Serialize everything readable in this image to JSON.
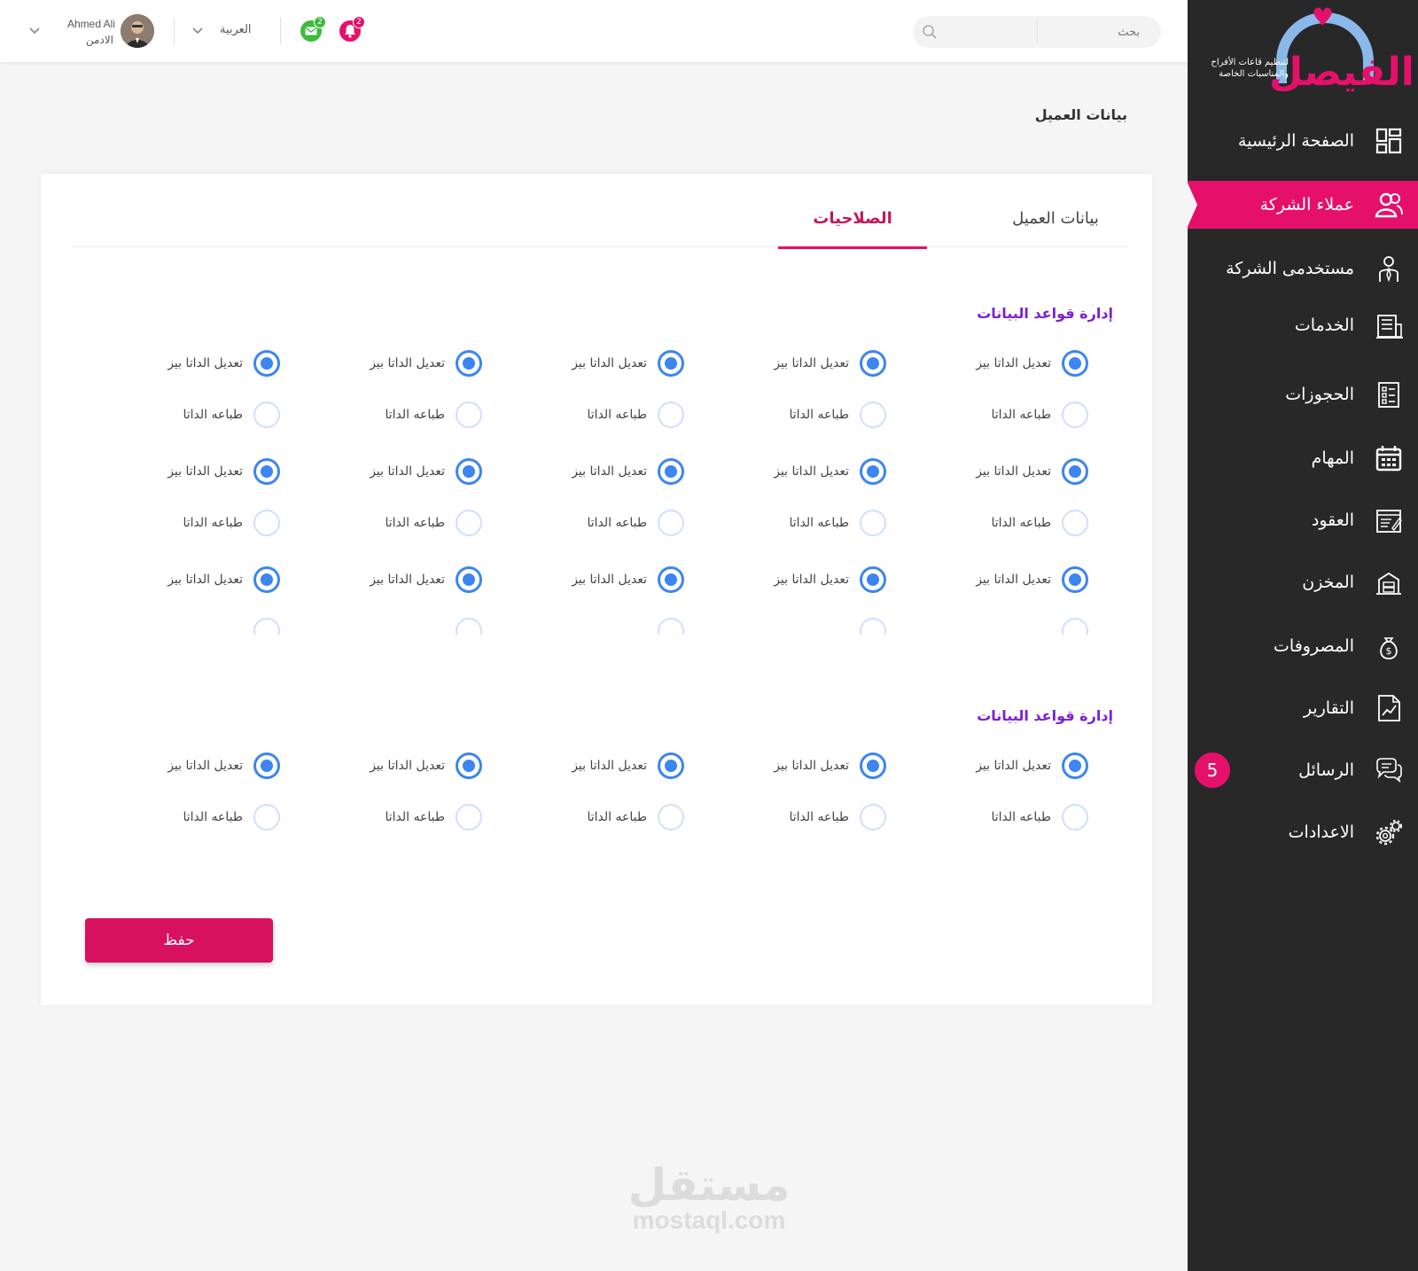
{
  "brand": {
    "name": "الفيصل",
    "tagline": "لتنظيم قاعات الأفراح والمناسبات الخاصة"
  },
  "sidebar": {
    "items": [
      {
        "label": "الصفحة الرئيسية",
        "icon": "dashboard-icon",
        "active": false
      },
      {
        "label": "عملاء الشركة",
        "icon": "users-icon",
        "active": true
      },
      {
        "label": "مستخدمى الشركة",
        "icon": "employee-icon",
        "active": false
      },
      {
        "label": "الخدمات",
        "icon": "building-icon",
        "active": false
      },
      {
        "label": "الحجوزات",
        "icon": "checklist-icon",
        "active": false
      },
      {
        "label": "المهام",
        "icon": "calendar-icon",
        "active": false
      },
      {
        "label": "العقود",
        "icon": "contract-icon",
        "active": false
      },
      {
        "label": "المخزن",
        "icon": "warehouse-icon",
        "active": false
      },
      {
        "label": "المصروفات",
        "icon": "money-bag-icon",
        "active": false
      },
      {
        "label": "التقارير",
        "icon": "report-icon",
        "active": false
      },
      {
        "label": "الرسائل",
        "icon": "chat-icon",
        "active": false,
        "badge": "5"
      },
      {
        "label": "الاعدادات",
        "icon": "gears-icon",
        "active": false
      }
    ]
  },
  "header": {
    "search_placeholder": "بحث",
    "notifications_count": "2",
    "messages_count": "2",
    "language": "العربية",
    "user_name": "Ahmed Ali",
    "user_role": "الادمن",
    "colors": {
      "notifications": "#e5106a",
      "messages": "#3dbb3d"
    }
  },
  "page": {
    "title": "بيانات العميل"
  },
  "tabs": [
    {
      "label": "بيانات العميل",
      "active": false
    },
    {
      "label": "الصلاحيات",
      "active": true
    }
  ],
  "sections": [
    {
      "title": "إدارة قواعد البيانات",
      "rows": [
        {
          "label": "تعديل الداتا بيز",
          "checked": true
        },
        {
          "label": "طباعه الداتا",
          "checked": false
        },
        {
          "label": "تعديل الداتا بيز",
          "checked": true
        },
        {
          "label": "طباعه الداتا",
          "checked": false
        },
        {
          "label": "تعديل الداتا بيز",
          "checked": true
        }
      ]
    },
    {
      "title": "إدارة قواعد البيانات",
      "rows": [
        {
          "label": "تعديل الداتا بيز",
          "checked": true
        },
        {
          "label": "طباعه الداتا",
          "checked": false
        }
      ]
    }
  ],
  "columns_per_row": 5,
  "save_label": "حفظ",
  "watermark": {
    "ar": "مستقل",
    "en": "mostaql.com"
  },
  "colors": {
    "accent": "#e5106a",
    "sidebar": "#282828",
    "radio": "#3d85f0",
    "section_title": "#7b20d6"
  }
}
